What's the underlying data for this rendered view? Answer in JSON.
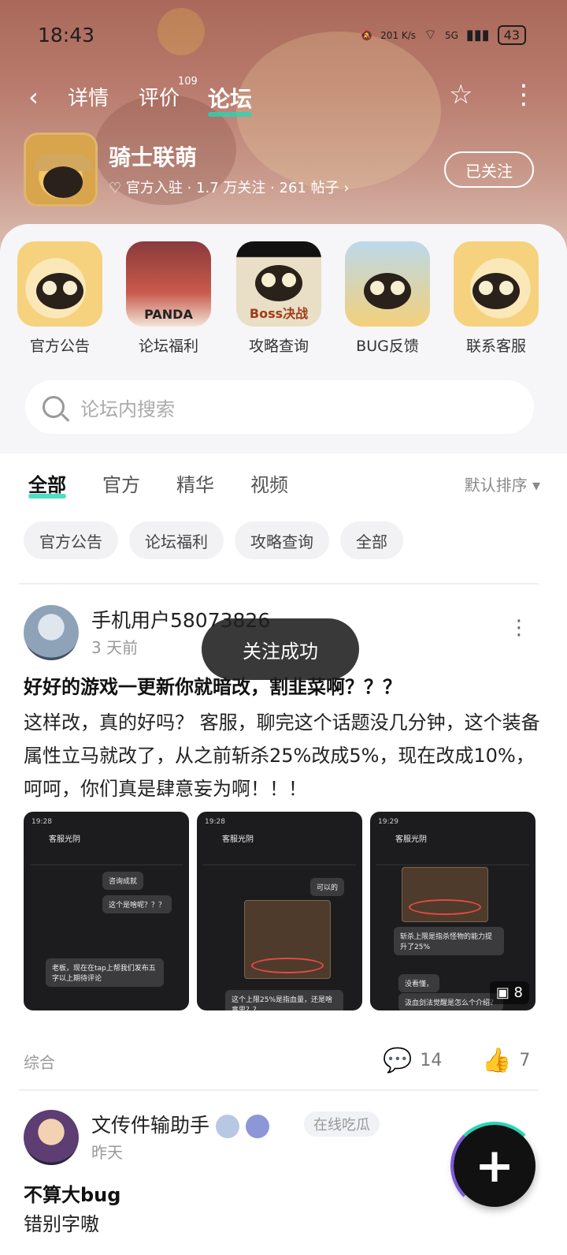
{
  "status": {
    "time": "18:43",
    "net_speed": "201 K/s",
    "network": "5G",
    "battery": "43"
  },
  "nav": {
    "back": "‹",
    "tabs": [
      "详情",
      "评价",
      "论坛"
    ],
    "review_badge": "109"
  },
  "forum": {
    "name": "骑士联萌",
    "stats": "官方入驻 · 1.7 万关注 · 261 帖子",
    "follow_label": "已关注"
  },
  "quick_entries": [
    {
      "label": "官方公告"
    },
    {
      "label": "论坛福利",
      "icon_text": "PANDA"
    },
    {
      "label": "攻略查询",
      "icon_text": "Boss决战"
    },
    {
      "label": "BUG反馈"
    },
    {
      "label": "联系客服"
    }
  ],
  "search": {
    "placeholder": "论坛内搜索"
  },
  "feed": {
    "tabs": [
      "全部",
      "官方",
      "精华",
      "视频"
    ],
    "sort": "默认排序 ▾",
    "chips": [
      "官方公告",
      "论坛福利",
      "攻略查询",
      "全部"
    ]
  },
  "posts": [
    {
      "user": "手机用户58073826",
      "time": "3 天前",
      "title": "好好的游戏一更新你就暗改，割韭菜啊？？？",
      "body": "这样改，真的好吗？ 客服，聊完这个话题没几分钟，这个装备属性立马就改了，从之前斩杀25%改成5%，现在改成10%，呵呵，你们真是肆意妄为啊！！！",
      "category": "综合",
      "comments": "14",
      "likes": "7",
      "image_more": "8",
      "thumbs": [
        {
          "time": "19:28",
          "title": "客服光阴",
          "b1": "咨询成就",
          "b2": "这个是啥呢？？？",
          "b3": "老板，现在在tap上帮我们发布五字以上期待评论"
        },
        {
          "time": "19:28",
          "title": "客服光阴",
          "b1": "可以的",
          "b2": "这个上限25%是指血量，还是啥意思？？"
        },
        {
          "time": "19:29",
          "title": "客服光阴",
          "b1": "斩杀上限是指杀怪物的能力提升了25%",
          "b2": "没看懂，",
          "b3": "汲血剑法觉醒是怎么个介绍？"
        }
      ]
    },
    {
      "user": "文传件输助手",
      "tag": "在线吃瓜",
      "time": "昨天",
      "title": "不算大bug",
      "body": "错别字嗷"
    }
  ],
  "toast": "关注成功",
  "colors": {
    "accent": "#26d4b6",
    "hero": "#b97b6d"
  }
}
